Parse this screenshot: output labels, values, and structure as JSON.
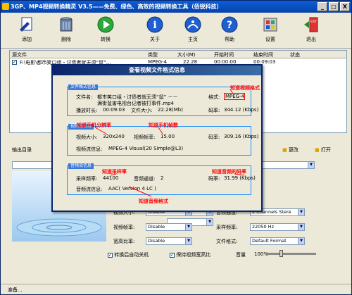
{
  "window": {
    "title": "3GP、MP4视频转换精灵 V3.5——免费、绿色、高效的视频转换工具（佰锐科技）",
    "min": "_",
    "max": "□",
    "close": "X"
  },
  "toolbar": [
    {
      "label": "添加",
      "icon": "add-file-icon"
    },
    {
      "label": "删除",
      "icon": "trash-icon"
    },
    {
      "label": "转换",
      "icon": "convert-play-icon"
    },
    {
      "label": "关于",
      "icon": "info-icon"
    },
    {
      "label": "主页",
      "icon": "home-icon"
    },
    {
      "label": "帮助",
      "icon": "help-icon"
    },
    {
      "label": "设置",
      "icon": "settings-icon"
    },
    {
      "label": "退出",
      "icon": "exit-icon"
    }
  ],
  "filelist": {
    "headers": [
      "源文件",
      "类型",
      "大小(M)",
      "开始时间",
      "结束时间",
      "状态"
    ],
    "rows": [
      {
        "file": "F:\\电影\\都市笑口组・讨债者就无须“鼠”…",
        "type": "MPEG-4",
        "size": "22.28",
        "start": "00:00:00",
        "end": "00:09:03",
        "status": ""
      }
    ]
  },
  "lower": {
    "output_label": "输出目录",
    "change": "更改",
    "open": "打开",
    "labels": {
      "vsize": "视频大小:",
      "vrate": "视频帧率:",
      "aspect": "宽高比率:",
      "achan": "音频通道:",
      "srate": "采样频率:",
      "fformat": "文件格式:",
      "volume": "音量"
    },
    "values": {
      "vsize": "Disable",
      "vrate": "Disable",
      "aspect": "Disable",
      "achan": "2 Channels Stere",
      "srate": "22050 Hz",
      "fformat": "Default Format"
    },
    "volume_pct": "100%",
    "checks": {
      "shutdown": "转换后自动关机",
      "keep_ratio": "保持视频宽高比"
    }
  },
  "status": "准备...",
  "dialog": {
    "title": "查看视频文件格式信息",
    "file_group": {
      "tag": "文件格式信息",
      "filename_label": "文件名:",
      "filename_line1": "都市笑口组・讨债者就无须“鼠” －－",
      "filename_line2": "满街鼠害电视台记者被打事件.mp4",
      "format_label": "格式:",
      "format_value": "MPEG-4",
      "duration_label": "播放时长:",
      "duration_value": "00:09:03",
      "size_label": "文件大小:",
      "size_value": "22.28(Mb)",
      "bitrate_label": "码率:",
      "bitrate_value": "344.12 (Kbps)"
    },
    "video_group": {
      "tag": "视频流信息",
      "vsize_label": "视频大小:",
      "vsize_value": "320x240",
      "fps_label": "视频帧率:",
      "fps_value": "15.00",
      "bitrate_label": "码率:",
      "bitrate_value": "309.16 (Kbps)",
      "codec_label": "视频流信息:",
      "codec_value": "MPEG-4 Visual(20  Simple@L3)"
    },
    "audio_group": {
      "tag": "音频流信息",
      "srate_label": "采样频率:",
      "srate_value": "44100",
      "chan_label": "音频通道:",
      "chan_value": "2",
      "bitrate_label": "码率:",
      "bitrate_value": "31.99 (Kbps)",
      "codec_label": "音频流信息:",
      "codec_value": "AAC( Version 4 LC )"
    }
  },
  "annotations": {
    "format": "知道视频格式",
    "resolution": "知道手机分辨率",
    "fps": "知道手机帧数",
    "samplerate": "知道采样率",
    "audio_bitrate": "知道音频的码率",
    "audio_format": "知道音频格式"
  },
  "colors": {
    "title_bar": "#0a5fd8",
    "annotation": "#ff0000",
    "group_border": "#1e90ff"
  }
}
